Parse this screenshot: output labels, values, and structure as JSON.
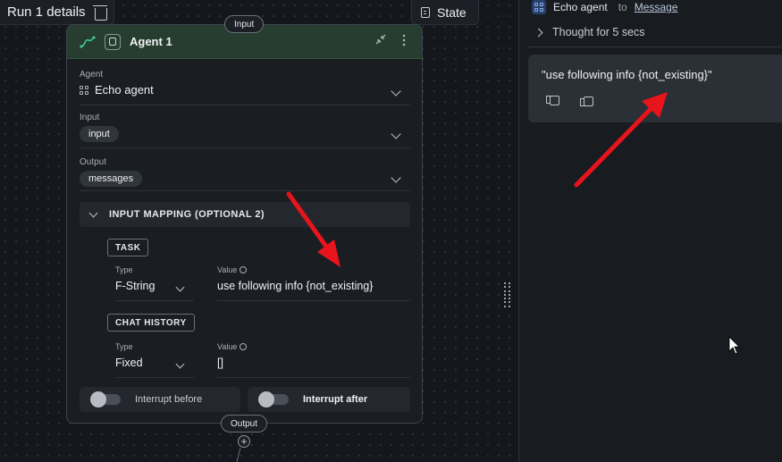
{
  "canvas": {
    "run_title": "Run 1 details",
    "state_label": "State",
    "input_port": "Input",
    "output_port": "Output",
    "plus": "+"
  },
  "node": {
    "title": "Agent 1",
    "agent": {
      "label": "Agent",
      "value": "Echo agent"
    },
    "input": {
      "label": "Input",
      "value": "input"
    },
    "output": {
      "label": "Output",
      "value": "messages"
    },
    "mapping_title": "INPUT MAPPING (OPTIONAL 2)",
    "task": {
      "tag": "TASK",
      "type_label": "Type",
      "type_value": "F-String",
      "value_label": "Value",
      "value": "use following info {not_existing}"
    },
    "chat_history": {
      "tag": "CHAT HISTORY",
      "type_label": "Type",
      "type_value": "Fixed",
      "value_label": "Value",
      "value": "[]"
    },
    "interrupt_before": "Interrupt before",
    "interrupt_after": "Interrupt after"
  },
  "panel": {
    "sender": "Echo agent",
    "to": "to",
    "recipient": "Message",
    "thought": "Thought for 5 secs",
    "message": "\"use following info {not_existing}\""
  },
  "colors": {
    "node_header": "#263d2f",
    "arrow": "#e8141b",
    "accent_link": "#b9c7de"
  }
}
